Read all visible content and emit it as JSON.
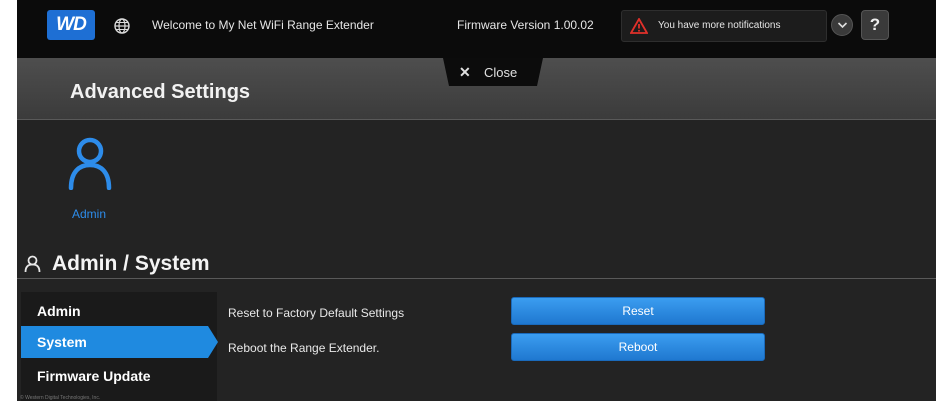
{
  "topbar": {
    "logo_text": "WD",
    "globe_icon": "globe-icon",
    "welcome": "Welcome to My Net WiFi Range Extender",
    "firmware": "Firmware Version 1.00.02",
    "notification": "You have more notifications",
    "warning_icon": "warning-icon",
    "help_label": "?"
  },
  "panel": {
    "title": "Advanced Settings",
    "close_label": "Close"
  },
  "tiles": [
    {
      "label": "Admin",
      "icon": "user-icon"
    }
  ],
  "section": {
    "title": "Admin / System",
    "icon": "user-icon"
  },
  "nav": {
    "items": [
      {
        "label": "Admin",
        "active": false
      },
      {
        "label": "System",
        "active": true
      },
      {
        "label": "Firmware Update",
        "active": false
      }
    ],
    "copyright": "© Western Digital Technologies, Inc."
  },
  "content": {
    "rows": [
      {
        "label": "Reset to Factory Default Settings",
        "button": "Reset"
      },
      {
        "label": "Reboot the Range Extender.",
        "button": "Reboot"
      }
    ]
  },
  "colors": {
    "accent": "#1f8ae0",
    "background": "#232323",
    "topbar": "#0b0b0b"
  }
}
